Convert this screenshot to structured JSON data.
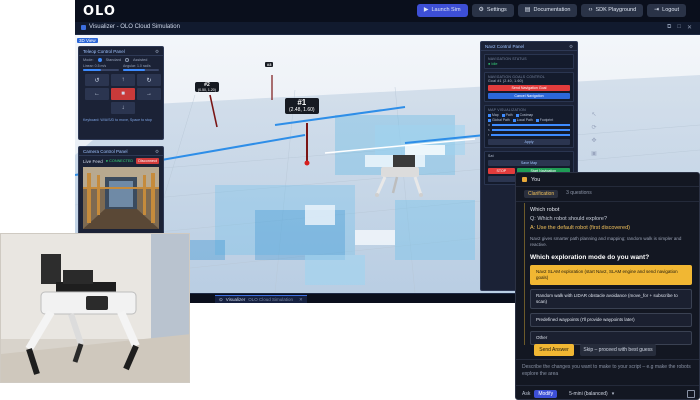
{
  "app": {
    "brand": "OLO",
    "window_title": "Visualizer - OLO Cloud Simulation",
    "nav": [
      {
        "label": "Launch Sim",
        "icon": "play-icon"
      },
      {
        "label": "Settings",
        "icon": "gear-icon"
      },
      {
        "label": "Documentation",
        "icon": "book-icon"
      },
      {
        "label": "SDK Playground",
        "icon": "code-icon"
      },
      {
        "label": "Logout",
        "icon": "logout-icon"
      }
    ],
    "viewport_label": "3D View"
  },
  "teleop": {
    "title": "Teleop Control Panel",
    "mode_label": "Mode:",
    "mode_opts": [
      "Standard",
      "Assisted"
    ],
    "linear_label": "Linear: 0.5 m/s",
    "angular_label": "Angular: 1.0 rad/s",
    "keys": [
      "↺",
      "↑",
      "↻",
      "←",
      "■",
      "→",
      "↓"
    ],
    "footer": "Keyboard: W/A/S/D to move, Space to stop"
  },
  "camera": {
    "title": "Camera Control Panel",
    "feed_label": "Live Feed",
    "status": "● CONNECTED",
    "disconnect_label": "Disconnect"
  },
  "nav_panel": {
    "title": "Nav2 Control Panel",
    "nav_status_title": "NAVIGATION STATUS",
    "nav_status_value": "● Idle",
    "goal_title": "NAVIGATION GOALS CONTROL",
    "goal_hint": "Goal #1 (2.40, 1.60)",
    "send_goal_label": "Send Navigation Goal",
    "cancel_label": "Cancel Navigation",
    "viz_title": "MAP VISUALIZATION",
    "viz_opts": [
      "Map",
      "Path",
      "Costmap",
      "Global Path",
      "Local Path",
      "Footprint"
    ],
    "apply_label": "Apply",
    "sat_label": "Sat",
    "save_label": "Save Map",
    "stop_label": "STOP",
    "start_label": "Start Navigation",
    "reset_label": "Reset Navigation"
  },
  "markers": [
    {
      "label": "#1",
      "coords": "(2.48, 1.60)"
    },
    {
      "label": "#2",
      "coords": "(0.50, 1.20)"
    },
    {
      "label": "#3",
      "coords": ""
    }
  ],
  "bottom_tabs": [
    {
      "label": "Visualizer",
      "sub": "OLO Cloud Simulation"
    }
  ],
  "chat": {
    "title": "You",
    "tabs": [
      "Clarification",
      "3 questions"
    ],
    "q1_heading": "Which robot",
    "q1": "Q: Which robot should explore?",
    "a1": "A: Use the default robot (first discovered)",
    "note": "Nav2 gives smarter path planning and mapping; random walk is simpler and reactive.",
    "q2": "Which exploration mode do you want?",
    "options": [
      "Nav2 SLAM exploration (start Nav2, SLAM engine and send navigation goals)",
      "Random walk with LIDAR obstacle avoidance (move_for + subscribe to scan)",
      "Predefined waypoints (I'll provide waypoints later)",
      "Other"
    ],
    "send_label": "Send Answer",
    "skip_label": "Skip – proceed with best guess",
    "composer_placeholder": "Describe the changes you want to make to your script – e.g make the robots explore the area",
    "mode_ask": "Ask",
    "mode_modify": "Modify",
    "model": "5-mini (balanced)"
  },
  "colors": {
    "accent": "#3d4fd6",
    "danger": "#e23c3c",
    "chat_highlight": "#f1b733",
    "success": "#36d67a"
  }
}
